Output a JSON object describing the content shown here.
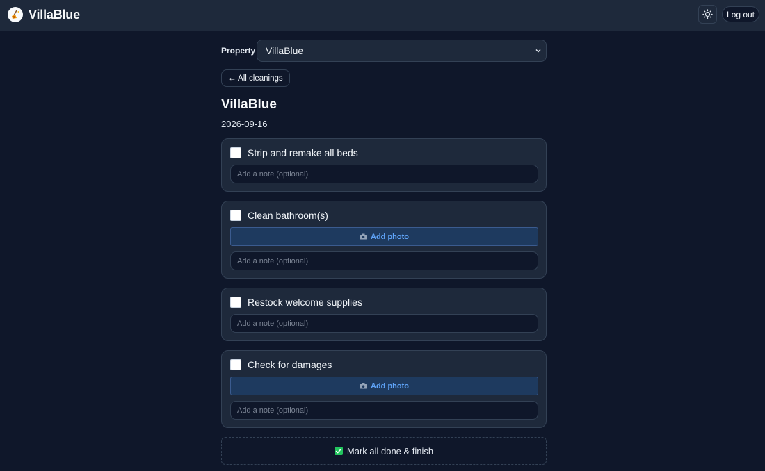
{
  "app": {
    "name": "VillaBlue",
    "logout_label": "Log out"
  },
  "property": {
    "label": "Property",
    "selected": "VillaBlue"
  },
  "back_label": "← All cleanings",
  "cleaning": {
    "title": "VillaBlue",
    "date": "2026-09-16"
  },
  "note_placeholder": "Add a note (optional)",
  "add_photo_label": "Add photo",
  "tasks": [
    {
      "label": "Strip and remake all beds",
      "checked": false,
      "photo": false
    },
    {
      "label": "Clean bathroom(s)",
      "checked": false,
      "photo": true
    },
    {
      "label": "Restock welcome supplies",
      "checked": false,
      "photo": false
    },
    {
      "label": "Check for damages",
      "checked": false,
      "photo": true
    }
  ],
  "finish_label": "Mark all done & finish",
  "colors": {
    "background": "#0f172a",
    "surface": "#1e293b",
    "accent": "#60a5fa",
    "success": "#22c55e"
  }
}
